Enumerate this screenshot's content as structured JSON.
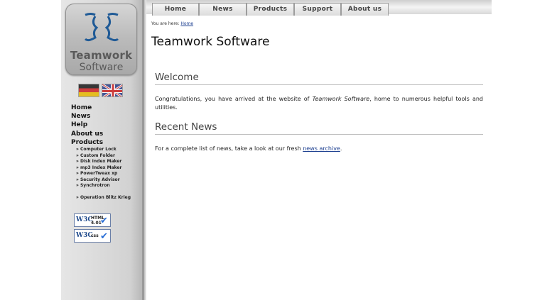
{
  "logo": {
    "line1": "Teamwork",
    "line2": "Software"
  },
  "flags": {
    "de": "german-flag-icon",
    "uk": "uk-flag-icon"
  },
  "nav": {
    "items": [
      {
        "label": "Home"
      },
      {
        "label": "News"
      },
      {
        "label": "Help"
      },
      {
        "label": "About us"
      },
      {
        "label": "Products"
      }
    ],
    "products": [
      "» Computer Lock",
      "» Custom Folder",
      "» Disk Index Maker",
      "» mp3 Index Maker",
      "» PowerTweax xp",
      "» Security Advisor",
      "» Synchrotron"
    ],
    "extra": "» Operation Blitz Krieg"
  },
  "badges": [
    {
      "logo": "W3C",
      "line1": "HTML",
      "line2": "4.01"
    },
    {
      "logo": "W3C",
      "line1": "css",
      "line2": ""
    }
  ],
  "tabs": [
    "Home",
    "News",
    "Products",
    "Support",
    "About us"
  ],
  "breadcrumb": {
    "prefix": "You are here:",
    "link": "Home"
  },
  "page": {
    "title": "Teamwork Software",
    "welcome_heading": "Welcome",
    "welcome_text_1": "Congratulations, you have arrived at the website of ",
    "welcome_text_em": "Teamwork Software",
    "welcome_text_2": ", home to numerous helpful tools and utilities.",
    "news_heading": "Recent News",
    "news_text_1": "For a complete list of news, take a look at our fresh ",
    "news_link": "news archive",
    "news_text_2": "."
  },
  "colors": {
    "link": "#1a3d8f",
    "sidebar": "#d2d2d2"
  }
}
